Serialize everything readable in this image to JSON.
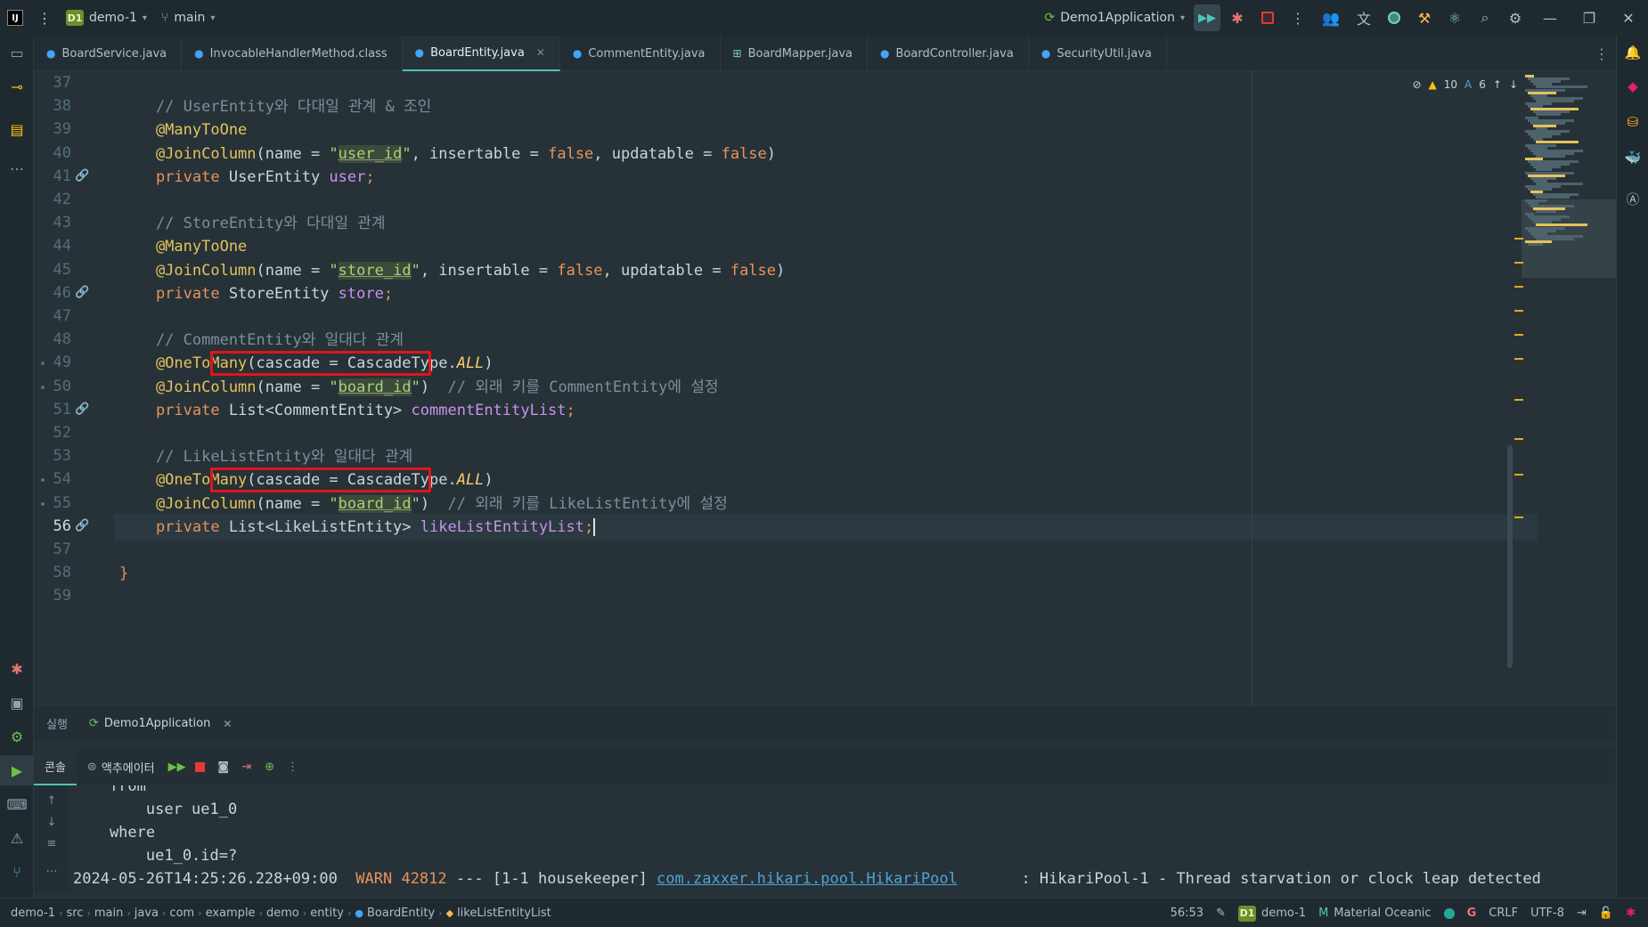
{
  "titlebar": {
    "project_badge": "D1",
    "project_name": "demo-1",
    "branch": "main",
    "run_config": "Demo1Application"
  },
  "tabs": [
    {
      "label": "BoardService.java",
      "active": false
    },
    {
      "label": "InvocableHandlerMethod.class",
      "active": false
    },
    {
      "label": "BoardEntity.java",
      "active": true
    },
    {
      "label": "CommentEntity.java",
      "active": false
    },
    {
      "label": "BoardMapper.java",
      "active": false
    },
    {
      "label": "BoardController.java",
      "active": false
    },
    {
      "label": "SecurityUtil.java",
      "active": false
    }
  ],
  "editor": {
    "inspections": {
      "warnings": "10",
      "typos": "6"
    },
    "current_line": 56,
    "lines": [
      {
        "n": "37",
        "parts": []
      },
      {
        "n": "38",
        "parts": [
          {
            "t": "    // UserEntity와 다대일 관계 & 조인",
            "c": "cmt"
          }
        ]
      },
      {
        "n": "39",
        "parts": [
          {
            "t": "    @ManyToOne",
            "c": "ann"
          }
        ]
      },
      {
        "n": "40",
        "parts": [
          {
            "t": "    @JoinColumn",
            "c": "ann"
          },
          {
            "t": "(name = ",
            "c": "typ"
          },
          {
            "t": "\"",
            "c": "str"
          },
          {
            "t": "user_id",
            "c": "strh"
          },
          {
            "t": "\"",
            "c": "str"
          },
          {
            "t": ", insertable = ",
            "c": "typ"
          },
          {
            "t": "false",
            "c": "kw"
          },
          {
            "t": ", updatable = ",
            "c": "typ"
          },
          {
            "t": "false",
            "c": "kw"
          },
          {
            "t": ")",
            "c": "typ"
          }
        ]
      },
      {
        "n": "41",
        "parts": [
          {
            "t": "    private ",
            "c": "kwb"
          },
          {
            "t": "UserEntity ",
            "c": "typ"
          },
          {
            "t": "user",
            "c": "fld"
          },
          {
            "t": ";",
            "c": "kw"
          }
        ]
      },
      {
        "n": "42",
        "parts": []
      },
      {
        "n": "43",
        "parts": [
          {
            "t": "    // StoreEntity와 다대일 관계",
            "c": "cmt"
          }
        ]
      },
      {
        "n": "44",
        "parts": [
          {
            "t": "    @ManyToOne",
            "c": "ann"
          }
        ]
      },
      {
        "n": "45",
        "parts": [
          {
            "t": "    @JoinColumn",
            "c": "ann"
          },
          {
            "t": "(name = ",
            "c": "typ"
          },
          {
            "t": "\"",
            "c": "str"
          },
          {
            "t": "store_id",
            "c": "strh"
          },
          {
            "t": "\"",
            "c": "str"
          },
          {
            "t": ", insertable = ",
            "c": "typ"
          },
          {
            "t": "false",
            "c": "kw"
          },
          {
            "t": ", updatable = ",
            "c": "typ"
          },
          {
            "t": "false",
            "c": "kw"
          },
          {
            "t": ")",
            "c": "typ"
          }
        ]
      },
      {
        "n": "46",
        "parts": [
          {
            "t": "    private ",
            "c": "kwb"
          },
          {
            "t": "StoreEntity ",
            "c": "typ"
          },
          {
            "t": "store",
            "c": "fld"
          },
          {
            "t": ";",
            "c": "kw"
          }
        ]
      },
      {
        "n": "47",
        "parts": []
      },
      {
        "n": "48",
        "parts": [
          {
            "t": "    // CommentEntity와 일대다 관계",
            "c": "cmt"
          }
        ]
      },
      {
        "n": "49",
        "parts": [
          {
            "t": "    @OneToMany",
            "c": "ann"
          },
          {
            "t": "(cascade = CascadeType.",
            "c": "typ"
          },
          {
            "t": "ALL",
            "c": "en"
          },
          {
            "t": ")",
            "c": "typ"
          }
        ]
      },
      {
        "n": "50",
        "parts": [
          {
            "t": "    @JoinColumn",
            "c": "ann"
          },
          {
            "t": "(name = ",
            "c": "typ"
          },
          {
            "t": "\"",
            "c": "str"
          },
          {
            "t": "board_id",
            "c": "strh"
          },
          {
            "t": "\"",
            "c": "str"
          },
          {
            "t": ")  ",
            "c": "typ"
          },
          {
            "t": "// 외래 키를 CommentEntity에 설정",
            "c": "cmt"
          }
        ]
      },
      {
        "n": "51",
        "parts": [
          {
            "t": "    private ",
            "c": "kwb"
          },
          {
            "t": "List<CommentEntity> ",
            "c": "typ"
          },
          {
            "t": "commentEntityList",
            "c": "fld"
          },
          {
            "t": ";",
            "c": "kw"
          }
        ]
      },
      {
        "n": "52",
        "parts": []
      },
      {
        "n": "53",
        "parts": [
          {
            "t": "    // LikeListEntity와 일대다 관계",
            "c": "cmt"
          }
        ]
      },
      {
        "n": "54",
        "parts": [
          {
            "t": "    @OneToMany",
            "c": "ann"
          },
          {
            "t": "(cascade = CascadeType.",
            "c": "typ"
          },
          {
            "t": "ALL",
            "c": "en"
          },
          {
            "t": ")",
            "c": "typ"
          }
        ]
      },
      {
        "n": "55",
        "parts": [
          {
            "t": "    @JoinColumn",
            "c": "ann"
          },
          {
            "t": "(name = ",
            "c": "typ"
          },
          {
            "t": "\"",
            "c": "str"
          },
          {
            "t": "board_id",
            "c": "strh"
          },
          {
            "t": "\"",
            "c": "str"
          },
          {
            "t": ")  ",
            "c": "typ"
          },
          {
            "t": "// 외래 키를 LikeListEntity에 설정",
            "c": "cmt"
          }
        ]
      },
      {
        "n": "56",
        "parts": [
          {
            "t": "    private ",
            "c": "kwb"
          },
          {
            "t": "List<LikeListEntity> ",
            "c": "typ"
          },
          {
            "t": "likeListEntityList",
            "c": "fld"
          },
          {
            "t": ";",
            "c": "kw"
          }
        ]
      },
      {
        "n": "57",
        "parts": []
      },
      {
        "n": "58",
        "parts": [
          {
            "t": "}",
            "c": "kw"
          }
        ]
      },
      {
        "n": "59",
        "parts": []
      }
    ]
  },
  "run_panel": {
    "label": "실행",
    "tab": "Demo1Application",
    "console_tab": "콘솔",
    "actuator_tab": "액추에이터",
    "lines": [
      {
        "segments": [
          {
            "t": "    from",
            "c": ""
          }
        ]
      },
      {
        "segments": [
          {
            "t": "        user ue1_0",
            "c": ""
          }
        ]
      },
      {
        "segments": [
          {
            "t": "    where",
            "c": ""
          }
        ]
      },
      {
        "segments": [
          {
            "t": "        ue1_0.id=?",
            "c": ""
          }
        ]
      },
      {
        "segments": [
          {
            "t": "2024-05-26T14:25:26.228+09:00  ",
            "c": ""
          },
          {
            "t": "WARN 42812",
            "c": "warn"
          },
          {
            "t": " --- [1-1 housekeeper] ",
            "c": ""
          },
          {
            "t": "com.zaxxer.hikari.pool.HikariPool",
            "c": "link"
          },
          {
            "t": "       : HikariPool-1 - Thread starvation or clock leap detected",
            "c": ""
          }
        ]
      }
    ]
  },
  "statusbar": {
    "breadcrumbs": [
      "demo-1",
      "src",
      "main",
      "java",
      "com",
      "example",
      "demo",
      "entity",
      "BoardEntity",
      "likeListEntityList"
    ],
    "position": "56:53",
    "project_badge": "D1",
    "project": "demo-1",
    "theme": "Material Oceanic",
    "line_ending": "CRLF",
    "encoding": "UTF-8"
  }
}
